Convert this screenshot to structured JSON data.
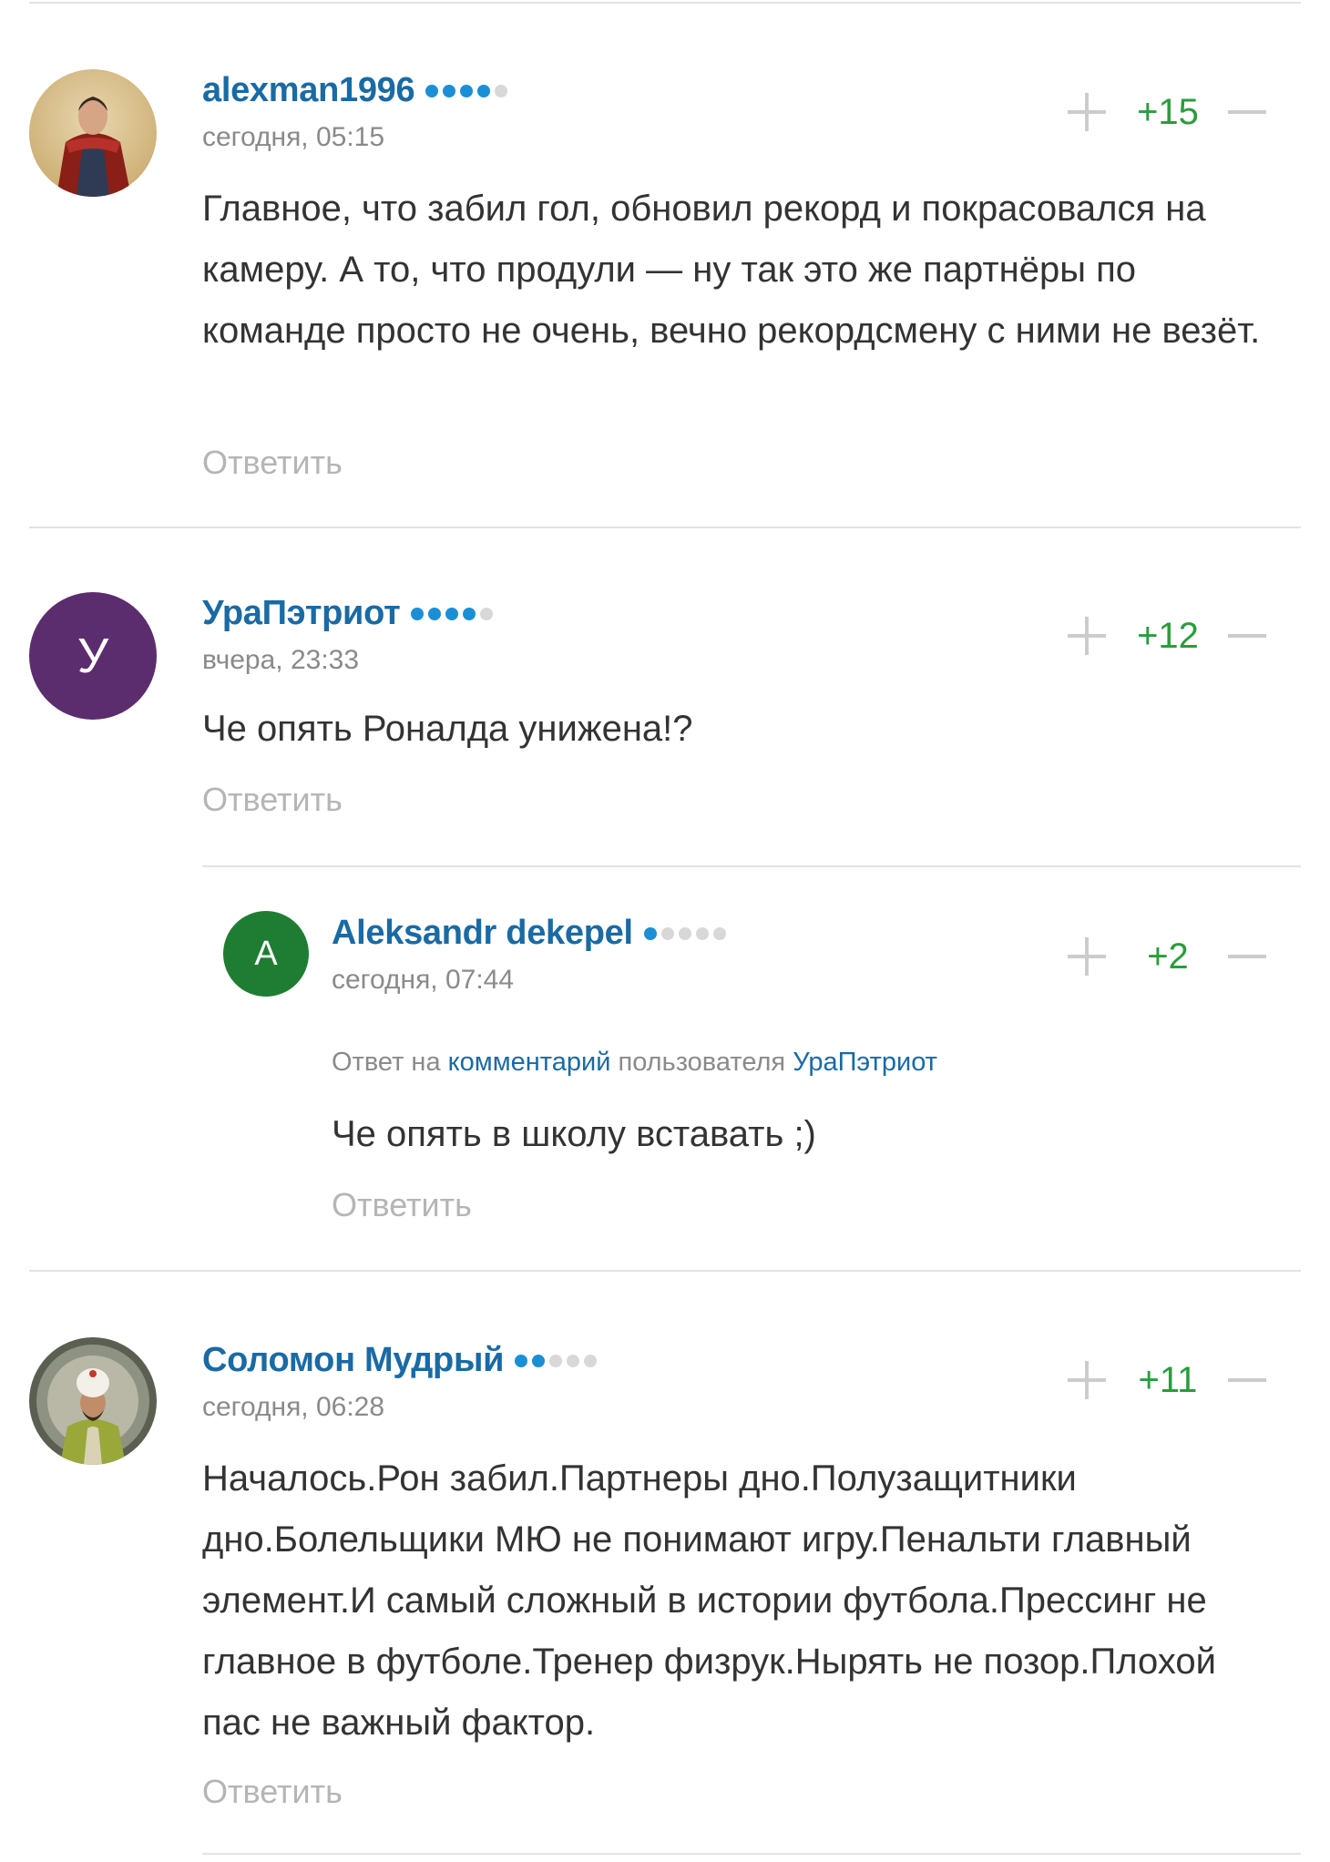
{
  "comments": [
    {
      "author": "alexman1996",
      "rating_dots": [
        true,
        true,
        true,
        true,
        false
      ],
      "date": "сегодня, 05:15",
      "text": "Главное, что забил гол, обновил рекорд и покрасовался на камеру. А то, что продули — ну так это же партнёры по команде просто не очень, вечно рекордсмену с ними не везёт.",
      "score": "+15",
      "reply_label": "Ответить"
    },
    {
      "author": "УраПэтриот",
      "avatar_letter": "У",
      "avatar_color": "#5b2d6e",
      "rating_dots": [
        true,
        true,
        true,
        true,
        false
      ],
      "date": "вчера, 23:33",
      "text": "Че опять Роналда унижена!?",
      "score": "+12",
      "reply_label": "Ответить"
    },
    {
      "author": "Aleksandr dekepel",
      "avatar_letter": "A",
      "avatar_color": "#1e7d32",
      "rating_dots": [
        true,
        false,
        false,
        false,
        false
      ],
      "date": "сегодня, 07:44",
      "reply_to": {
        "prefix": "Ответ на",
        "link": "комментарий",
        "middle": "пользователя",
        "user": "УраПэтриот"
      },
      "text": "Че опять в школу вставать ;)",
      "score": "+2",
      "reply_label": "Ответить"
    },
    {
      "author": "Соломон Мудрый",
      "rating_dots": [
        true,
        true,
        false,
        false,
        false
      ],
      "date": "сегодня, 06:28",
      "text": "Началось.Рон забил.Партнеры дно.Полузащитники дно.Болельщики МЮ не понимают игру.Пенальти главный элемент.И самый сложный в истории футбола.Прессинг не главное в футболе.Тренер физрук.Нырять не позор.Плохой пас не важный фактор.",
      "score": "+11",
      "reply_label": "Ответить"
    }
  ],
  "colors": {
    "author": "#1a6aa4",
    "score_positive": "#2a9c3c",
    "dot_active": "#1a8fd6",
    "dot_inactive": "#d8d8d8"
  }
}
